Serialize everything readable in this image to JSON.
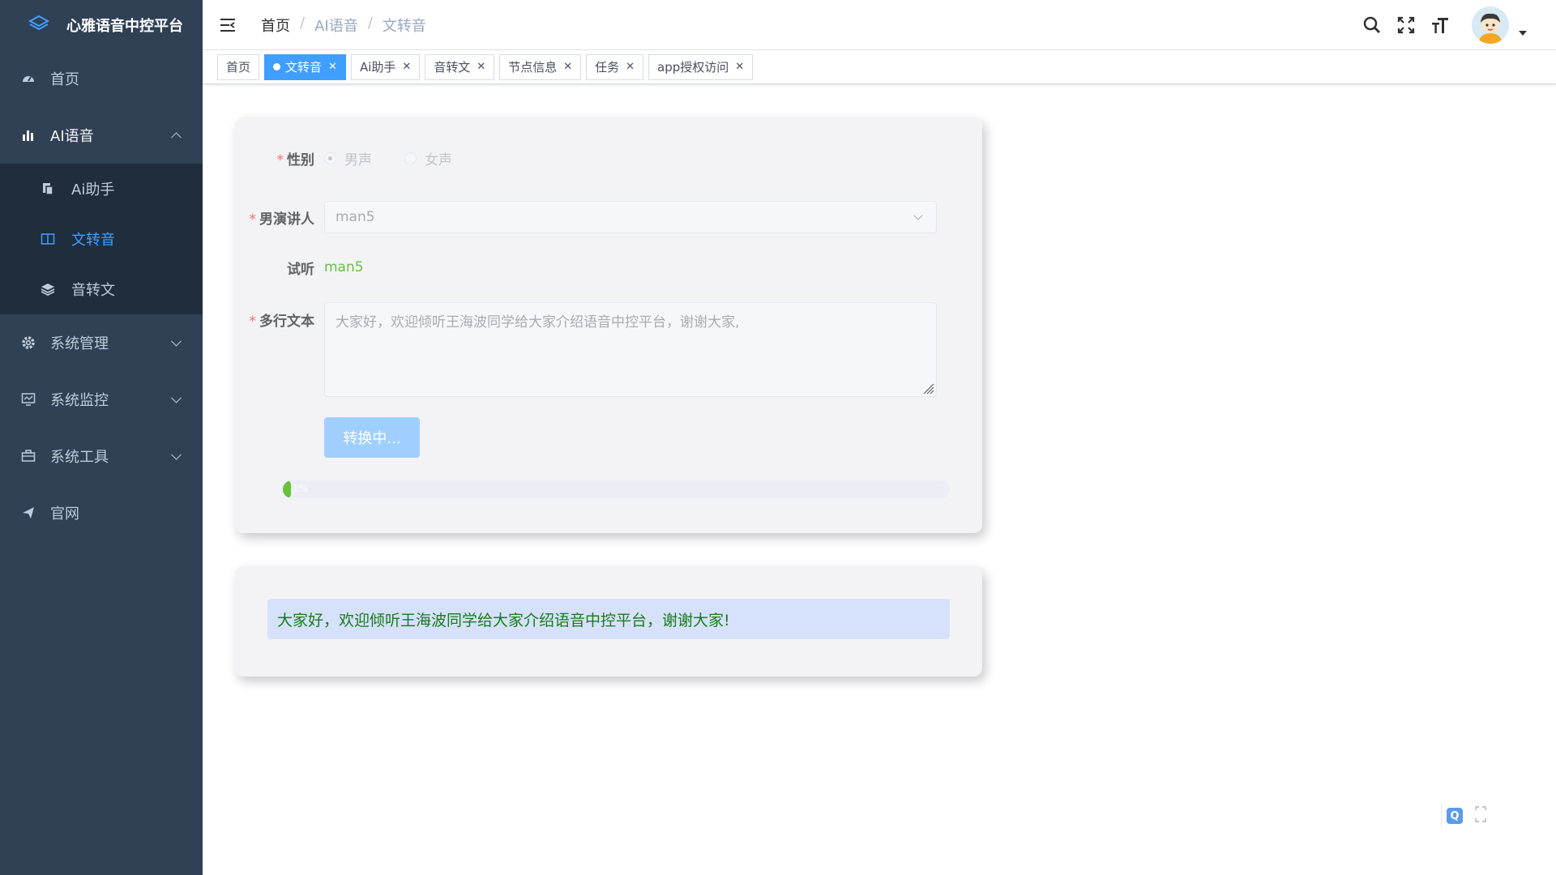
{
  "app": {
    "title": "心雅语音中控平台"
  },
  "sidebar": {
    "items": [
      {
        "label": "首页",
        "icon": "dashboard-icon"
      },
      {
        "label": "AI语音",
        "icon": "bar-chart-icon",
        "open": true,
        "children": [
          {
            "label": "Ai助手",
            "icon": "copy-icon"
          },
          {
            "label": "文转音",
            "icon": "book-icon",
            "active": true
          },
          {
            "label": "音转文",
            "icon": "layers-icon"
          }
        ]
      },
      {
        "label": "系统管理",
        "icon": "gear-icon"
      },
      {
        "label": "系统监控",
        "icon": "monitor-icon"
      },
      {
        "label": "系统工具",
        "icon": "toolbox-icon"
      },
      {
        "label": "官网",
        "icon": "send-icon"
      }
    ]
  },
  "breadcrumb": [
    "首页",
    "AI语音",
    "文转音"
  ],
  "tags": [
    {
      "label": "首页",
      "active": false,
      "closable": false
    },
    {
      "label": "文转音",
      "active": true,
      "closable": true
    },
    {
      "label": "Ai助手",
      "active": false,
      "closable": true
    },
    {
      "label": "音转文",
      "active": false,
      "closable": true
    },
    {
      "label": "节点信息",
      "active": false,
      "closable": true
    },
    {
      "label": "任务",
      "active": false,
      "closable": true
    },
    {
      "label": "app授权访问",
      "active": false,
      "closable": true
    }
  ],
  "form": {
    "gender": {
      "label": "性别",
      "options": [
        "男声",
        "女声"
      ],
      "selected": "男声"
    },
    "speaker": {
      "label": "男演讲人",
      "value": "man5"
    },
    "listen": {
      "label": "试听",
      "value": "man5"
    },
    "text": {
      "label": "多行文本",
      "value": "大家好，欢迎倾听王海波同学给大家介绍语音中控平台，谢谢大家,"
    },
    "submit": {
      "label": "转换中..."
    },
    "progress": {
      "percent": 1,
      "text": "1%"
    }
  },
  "result": {
    "text": "大家好，欢迎倾听王海波同学给大家介绍语音中控平台，谢谢大家!"
  },
  "float_tool": {
    "q_label": "Q"
  },
  "colors": {
    "sidebar_bg": "#304156",
    "submenu_bg": "#1f2d3d",
    "accent": "#409eff",
    "success": "#67c23a"
  }
}
